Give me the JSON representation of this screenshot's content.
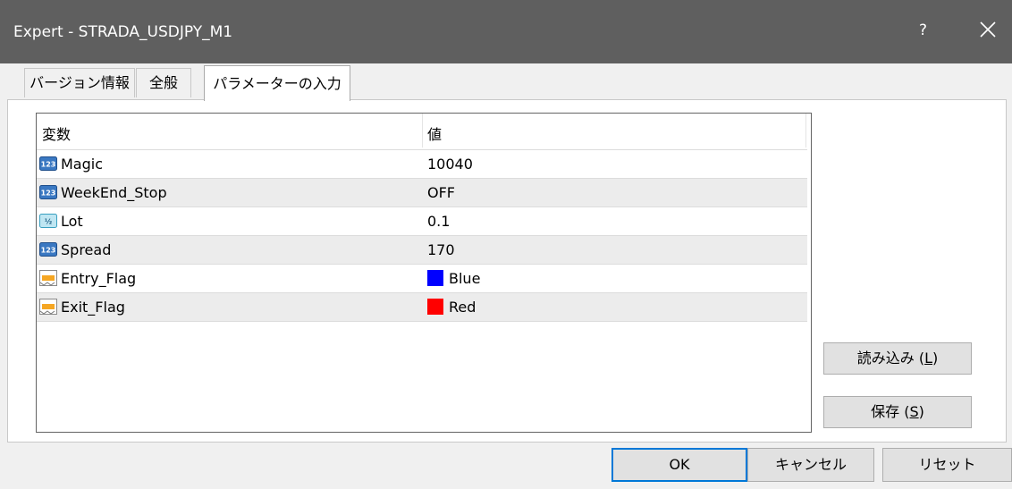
{
  "window": {
    "title": "Expert - STRADA_USDJPY_M1",
    "help_label": "?"
  },
  "tabs": [
    {
      "label": "バージョン情報"
    },
    {
      "label": "全般"
    },
    {
      "label": "パラメーターの入力"
    }
  ],
  "grid": {
    "columns": [
      "変数",
      "値"
    ],
    "rows": [
      {
        "name": "Magic",
        "value": "10040",
        "icon": "integer-icon"
      },
      {
        "name": "WeekEnd_Stop",
        "value": "OFF",
        "icon": "integer-icon"
      },
      {
        "name": "Lot",
        "value": "0.1",
        "icon": "double-icon"
      },
      {
        "name": "Spread",
        "value": "170",
        "icon": "integer-icon"
      },
      {
        "name": "Entry_Flag",
        "value": "Blue",
        "icon": "color-icon",
        "color": "#0000ff"
      },
      {
        "name": "Exit_Flag",
        "value": "Red",
        "icon": "color-icon",
        "color": "#ff0000"
      }
    ]
  },
  "buttons": {
    "load": {
      "label": "読み込み (",
      "key": "L",
      "suffix": ")"
    },
    "save": {
      "label": "保存 (",
      "key": "S",
      "suffix": ")"
    },
    "ok": "OK",
    "cancel": "キャンセル",
    "reset": "リセット"
  },
  "colors": {
    "titlebar": "#5f5f5f",
    "accent": "#0078d7"
  }
}
